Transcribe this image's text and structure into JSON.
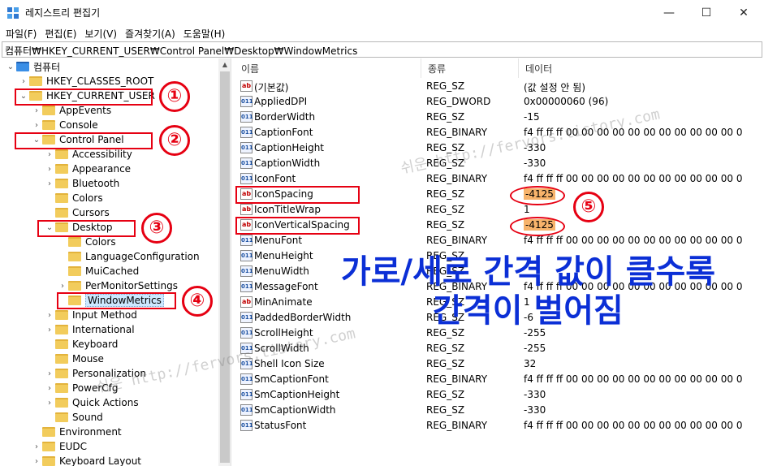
{
  "window": {
    "title": "레지스트리 편집기",
    "minimize_glyph": "—",
    "maximize_glyph": "☐",
    "close_glyph": "✕"
  },
  "menu": [
    "파일(F)",
    "편집(E)",
    "보기(V)",
    "즐겨찾기(A)",
    "도움말(H)"
  ],
  "address": "컴퓨터₩HKEY_CURRENT_USER₩Control Panel₩Desktop₩WindowMetrics",
  "tree": [
    {
      "label": "컴퓨터",
      "depth": 0,
      "expander": "expanded",
      "icon": "computer-icon"
    },
    {
      "label": "HKEY_CLASSES_ROOT",
      "depth": 1,
      "expander": "collapsed"
    },
    {
      "label": "HKEY_CURRENT_USER",
      "depth": 1,
      "expander": "expanded"
    },
    {
      "label": "AppEvents",
      "depth": 2,
      "expander": "collapsed"
    },
    {
      "label": "Console",
      "depth": 2,
      "expander": "collapsed"
    },
    {
      "label": "Control Panel",
      "depth": 2,
      "expander": "expanded"
    },
    {
      "label": "Accessibility",
      "depth": 3,
      "expander": "collapsed"
    },
    {
      "label": "Appearance",
      "depth": 3,
      "expander": "collapsed"
    },
    {
      "label": "Bluetooth",
      "depth": 3,
      "expander": "collapsed"
    },
    {
      "label": "Colors",
      "depth": 3,
      "expander": "none"
    },
    {
      "label": "Cursors",
      "depth": 3,
      "expander": "none"
    },
    {
      "label": "Desktop",
      "depth": 3,
      "expander": "expanded"
    },
    {
      "label": "Colors",
      "depth": 4,
      "expander": "none"
    },
    {
      "label": "LanguageConfiguration",
      "depth": 4,
      "expander": "none"
    },
    {
      "label": "MuiCached",
      "depth": 4,
      "expander": "none"
    },
    {
      "label": "PerMonitorSettings",
      "depth": 4,
      "expander": "collapsed"
    },
    {
      "label": "WindowMetrics",
      "depth": 4,
      "expander": "none",
      "selected": true
    },
    {
      "label": "Input Method",
      "depth": 3,
      "expander": "collapsed"
    },
    {
      "label": "International",
      "depth": 3,
      "expander": "collapsed"
    },
    {
      "label": "Keyboard",
      "depth": 3,
      "expander": "none"
    },
    {
      "label": "Mouse",
      "depth": 3,
      "expander": "none"
    },
    {
      "label": "Personalization",
      "depth": 3,
      "expander": "collapsed"
    },
    {
      "label": "PowerCfg",
      "depth": 3,
      "expander": "collapsed"
    },
    {
      "label": "Quick Actions",
      "depth": 3,
      "expander": "collapsed"
    },
    {
      "label": "Sound",
      "depth": 3,
      "expander": "none"
    },
    {
      "label": "Environment",
      "depth": 2,
      "expander": "none"
    },
    {
      "label": "EUDC",
      "depth": 2,
      "expander": "collapsed"
    },
    {
      "label": "Keyboard Layout",
      "depth": 2,
      "expander": "collapsed"
    }
  ],
  "columns": {
    "name": "이름",
    "type": "종류",
    "data": "데이터"
  },
  "values": [
    {
      "name": "(기본값)",
      "type": "REG_SZ",
      "data": "(값 설정 안 됨)",
      "kind": "sz"
    },
    {
      "name": "AppliedDPI",
      "type": "REG_DWORD",
      "data": "0x00000060 (96)",
      "kind": "bin"
    },
    {
      "name": "BorderWidth",
      "type": "REG_SZ",
      "data": "-15",
      "kind": "bin"
    },
    {
      "name": "CaptionFont",
      "type": "REG_BINARY",
      "data": "f4 ff ff ff 00 00 00 00 00 00 00 00 00 00 00 00 ...",
      "kind": "bin"
    },
    {
      "name": "CaptionHeight",
      "type": "REG_SZ",
      "data": "-330",
      "kind": "bin"
    },
    {
      "name": "CaptionWidth",
      "type": "REG_SZ",
      "data": "-330",
      "kind": "bin"
    },
    {
      "name": "IconFont",
      "type": "REG_BINARY",
      "data": "f4 ff ff ff 00 00 00 00 00 00 00 00 00 00 00 00 ...",
      "kind": "bin"
    },
    {
      "name": "IconSpacing",
      "type": "REG_SZ",
      "data": "-4125",
      "kind": "sz",
      "highlight": true
    },
    {
      "name": "IconTitleWrap",
      "type": "REG_SZ",
      "data": "1",
      "kind": "sz"
    },
    {
      "name": "IconVerticalSpacing",
      "type": "REG_SZ",
      "data": "-4125",
      "kind": "sz",
      "highlight": true
    },
    {
      "name": "MenuFont",
      "type": "REG_BINARY",
      "data": "f4 ff ff ff 00 00 00 00 00 00 00 00 00 00 00 00 ...",
      "kind": "bin"
    },
    {
      "name": "MenuHeight",
      "type": "REG_SZ",
      "data": "",
      "kind": "bin"
    },
    {
      "name": "MenuWidth",
      "type": "REG_SZ",
      "data": "",
      "kind": "bin"
    },
    {
      "name": "MessageFont",
      "type": "REG_BINARY",
      "data": "f4 ff ff ff 00 00 00 00 00 00 00 00 00 00 00 00 ...",
      "kind": "bin"
    },
    {
      "name": "MinAnimate",
      "type": "REG_SZ",
      "data": "1",
      "kind": "sz"
    },
    {
      "name": "PaddedBorderWidth",
      "type": "REG_SZ",
      "data": "-6",
      "kind": "bin"
    },
    {
      "name": "ScrollHeight",
      "type": "REG_SZ",
      "data": "-255",
      "kind": "bin"
    },
    {
      "name": "ScrollWidth",
      "type": "REG_SZ",
      "data": "-255",
      "kind": "bin"
    },
    {
      "name": "Shell Icon Size",
      "type": "REG_SZ",
      "data": "32",
      "kind": "bin"
    },
    {
      "name": "SmCaptionFont",
      "type": "REG_BINARY",
      "data": "f4 ff ff ff 00 00 00 00 00 00 00 00 00 00 00 00 ...",
      "kind": "bin"
    },
    {
      "name": "SmCaptionHeight",
      "type": "REG_SZ",
      "data": "-330",
      "kind": "bin"
    },
    {
      "name": "SmCaptionWidth",
      "type": "REG_SZ",
      "data": "-330",
      "kind": "bin"
    },
    {
      "name": "StatusFont",
      "type": "REG_BINARY",
      "data": "f4 ff ff ff 00 00 00 00 00 00 00 00 00 00 00 00 ...",
      "kind": "bin"
    }
  ],
  "annotations": {
    "numbers": [
      "①",
      "②",
      "③",
      "④",
      "⑤"
    ],
    "caption_line1": "가로/세로 간격 값이 클수록",
    "caption_line2": "간격이 벌어짐",
    "watermark1": "쉬운 http://fervors.tistory.com",
    "watermark2": "쉬운 http://fervors.tistory.com",
    "accent_color": "#e60012",
    "caption_color": "#0b2fd6",
    "highlight_color": "#f7b36b"
  }
}
